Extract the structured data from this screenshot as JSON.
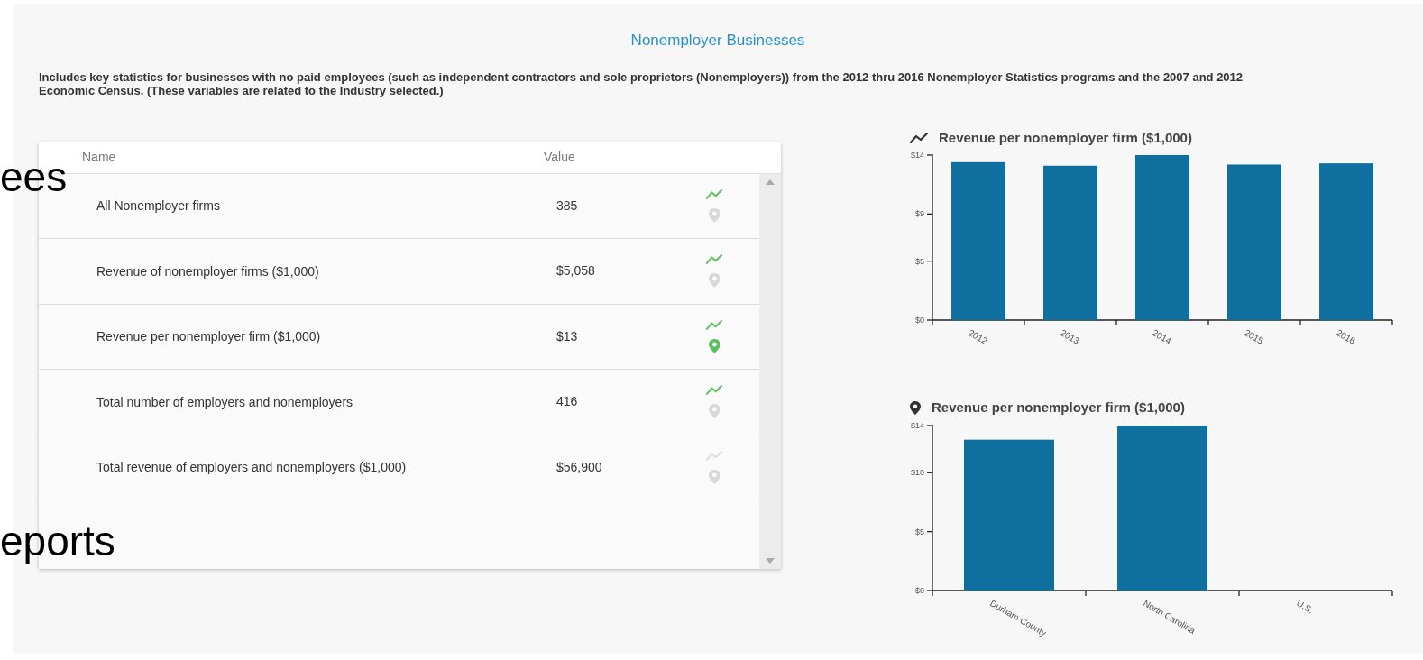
{
  "overlay_fragments": [
    {
      "text": "ees"
    },
    {
      "text": "eports"
    }
  ],
  "title": "Nonemployer Businesses",
  "description": "Includes key statistics for businesses with no paid employees (such as independent contractors and sole proprietors (Nonemployers)) from the 2012 thru 2016 Nonemployer Statistics programs and the 2007 and 2012 Economic Census. (These variables are related to the Industry selected.)",
  "table": {
    "columns": [
      "Name",
      "Value"
    ],
    "rows": [
      {
        "name": "All Nonemployer firms",
        "value": "385",
        "trend_available": true,
        "map_selected": false
      },
      {
        "name": "Revenue of nonemployer firms ($1,000)",
        "value": "$5,058",
        "trend_available": true,
        "map_selected": false
      },
      {
        "name": "Revenue per nonemployer firm ($1,000)",
        "value": "$13",
        "trend_available": true,
        "map_selected": true
      },
      {
        "name": "Total number of employers and nonemployers",
        "value": "416",
        "trend_available": true,
        "map_selected": false
      },
      {
        "name": "Total revenue of employers and nonemployers ($1,000)",
        "value": "$56,900",
        "trend_available": false,
        "map_selected": false
      }
    ]
  },
  "charts": [
    {
      "kind": "trend",
      "chart_data": {
        "type": "bar",
        "title": "Revenue per nonemployer firm ($1,000)",
        "categories": [
          "2012",
          "2013",
          "2014",
          "2015",
          "2016"
        ],
        "series": [
          {
            "color": "#0f70a0",
            "values": [
              13.4,
              13.1,
              14.0,
              13.2,
              13.3
            ]
          }
        ],
        "ylim": [
          0,
          14
        ],
        "yticks": [
          {
            "value": 0,
            "label": "$0"
          },
          {
            "value": 5,
            "label": "$5"
          },
          {
            "value": 9,
            "label": "$9"
          },
          {
            "value": 14,
            "label": "$14"
          }
        ]
      }
    },
    {
      "kind": "map",
      "chart_data": {
        "type": "bar",
        "title": "Revenue per nonemployer firm ($1,000)",
        "categories": [
          "Durham County",
          "North Carolina",
          "U.S."
        ],
        "series": [
          {
            "color": "#0f70a0",
            "values": [
              12.8,
              14.0,
              null
            ]
          }
        ],
        "ylim": [
          0,
          14
        ],
        "yticks": [
          {
            "value": 0,
            "label": "$0"
          },
          {
            "value": 5,
            "label": "$5"
          },
          {
            "value": 10,
            "label": "$10"
          },
          {
            "value": 14,
            "label": "$14"
          }
        ]
      }
    }
  ]
}
